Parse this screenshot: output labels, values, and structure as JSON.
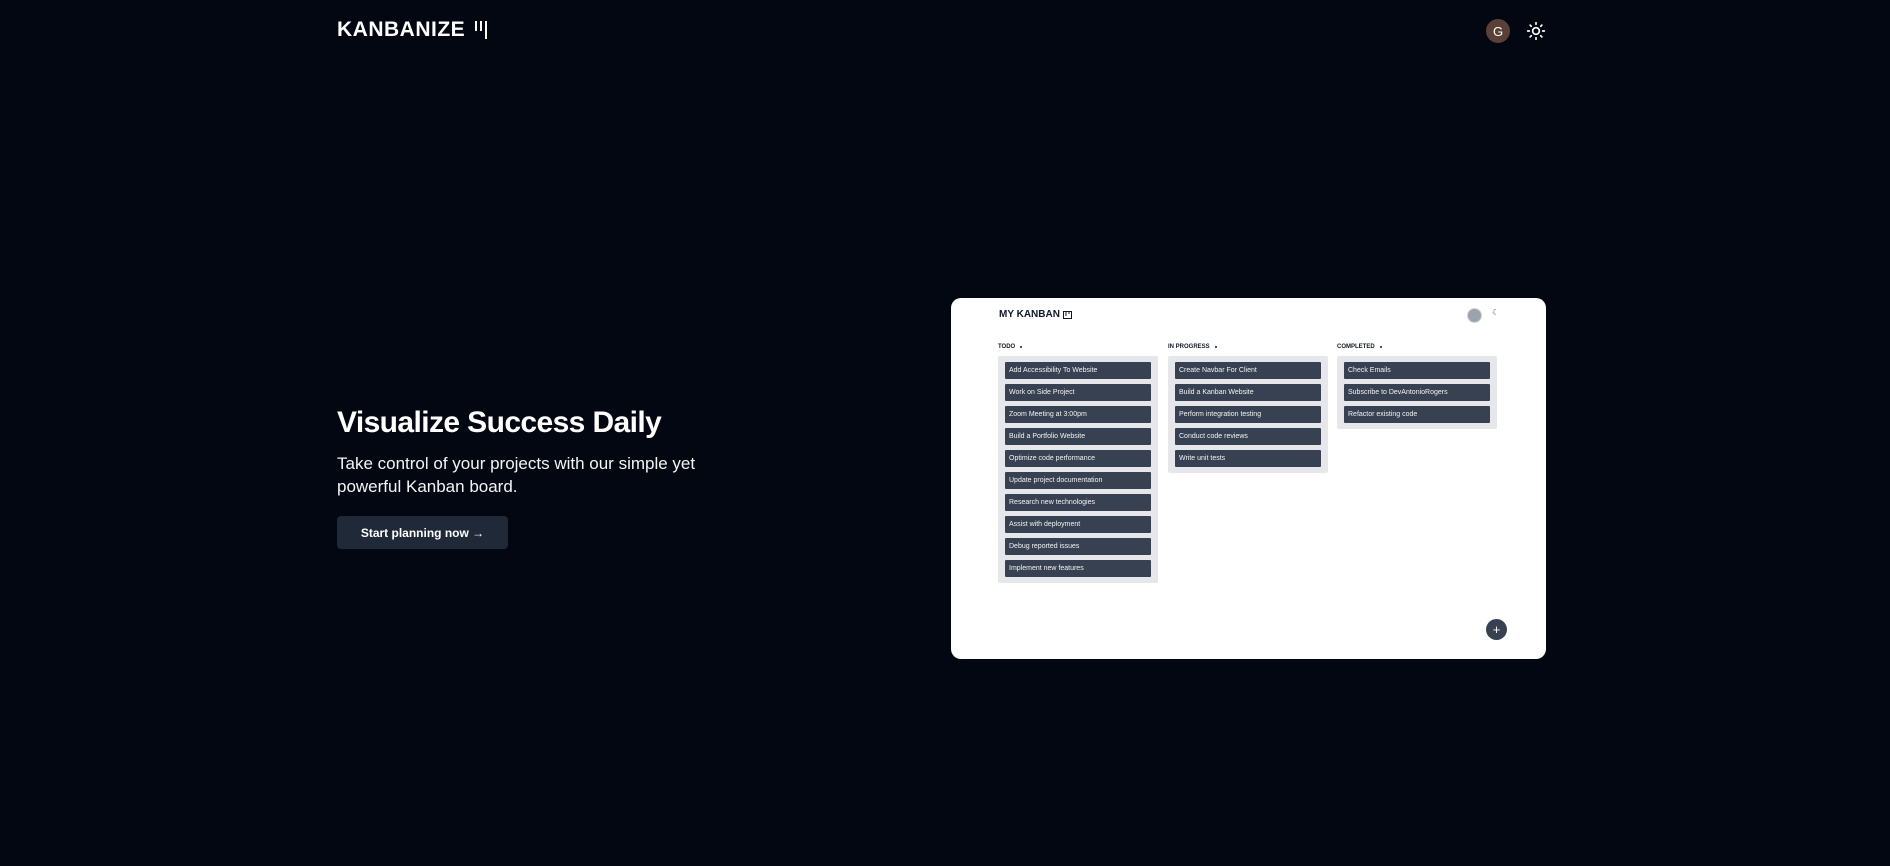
{
  "header": {
    "logo_text": "KANBANIZE",
    "avatar_initial": "G"
  },
  "hero": {
    "title": "Visualize Success Daily",
    "subtitle": "Take control of your projects with our simple yet powerful Kanban board.",
    "cta_label": "Start planning now →"
  },
  "preview": {
    "title": "MY KANBAN",
    "fab_label": "+",
    "columns": [
      {
        "label": "TODO",
        "cards": [
          "Add Accessibility To Website",
          "Work on Side Project",
          "Zoom Meeting at 3:00pm",
          "Build a Portfolio Website",
          "Optimize code performance",
          "Update project documentation",
          "Research new technologies",
          "Assist with deployment",
          "Debug reported issues",
          "Implement new features"
        ]
      },
      {
        "label": "IN PROGRESS",
        "cards": [
          "Create Navbar For Client",
          "Build a Kanban Website",
          "Perform integration testing",
          "Conduct code reviews",
          "Write unit tests"
        ]
      },
      {
        "label": "COMPLETED",
        "cards": [
          "Check Emails",
          "Subscribe to DevAntonioRogers",
          "Refactor existing code"
        ]
      }
    ]
  },
  "colors": {
    "background": "#030712",
    "button": "#1f2937",
    "card": "#374151",
    "column": "#e5e7eb",
    "avatar": "#5b4038"
  },
  "icons": {
    "logo_mark": "kanban-bars-icon",
    "theme": "sun-icon",
    "preview_theme": "moon-icon"
  }
}
